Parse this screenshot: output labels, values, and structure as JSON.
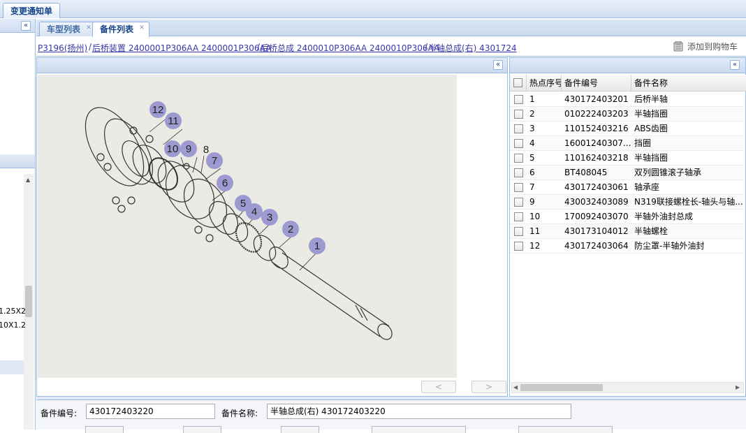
{
  "top_tab": "变更通知单",
  "tabs": [
    {
      "label": "车型列表",
      "active": false
    },
    {
      "label": "备件列表",
      "active": true
    }
  ],
  "left_fragments": [
    "1.25X2",
    "10X1.2"
  ],
  "breadcrumb": {
    "items": [
      "P3196(扬州)",
      "后桥装置 2400001P306AA 2400001P306AA",
      "后桥总成 2400010P306AA 2400010P306AA",
      "半轴总成(右)   4301724"
    ],
    "separator": "/"
  },
  "cart_label": "添加到购物车",
  "nav": {
    "prev": "<",
    "next": ">"
  },
  "collapse_glyph": "«",
  "callouts": [
    "12",
    "11",
    "10",
    "9",
    "8",
    "7",
    "6",
    "5",
    "4",
    "3",
    "2",
    "1"
  ],
  "grid": {
    "columns": [
      "热点序号",
      "备件编号",
      "备件名称"
    ],
    "rows": [
      {
        "seq": "1",
        "code": "430172403201",
        "name": "后桥半轴"
      },
      {
        "seq": "2",
        "code": "010222403203",
        "name": "半轴挡圈"
      },
      {
        "seq": "3",
        "code": "110152403216",
        "name": "ABS齿圈"
      },
      {
        "seq": "4",
        "code": "16001240307...",
        "name": "挡圈"
      },
      {
        "seq": "5",
        "code": "110162403218",
        "name": "半轴挡圈"
      },
      {
        "seq": "6",
        "code": "BT408045",
        "name": "双列圆锥滚子轴承"
      },
      {
        "seq": "7",
        "code": "430172403061",
        "name": "轴承座"
      },
      {
        "seq": "9",
        "code": "430032403089",
        "name": "N319联接螺栓长-轴头与轴..."
      },
      {
        "seq": "10",
        "code": "170092403070",
        "name": "半轴外油封总成"
      },
      {
        "seq": "11",
        "code": "430173104012",
        "name": "半轴螺栓"
      },
      {
        "seq": "12",
        "code": "430172403064",
        "name": "防尘罩-半轴外油封"
      }
    ]
  },
  "form": {
    "part_no_label": "备件编号:",
    "part_no_value": "430172403220",
    "part_name_label": "备件名称:",
    "part_name_value": "半轴总成(右)   430172403220"
  },
  "colors": {
    "callout_fill": "#9c9ad0",
    "link": "#3a37a8",
    "panel_border": "#99bbe8"
  }
}
